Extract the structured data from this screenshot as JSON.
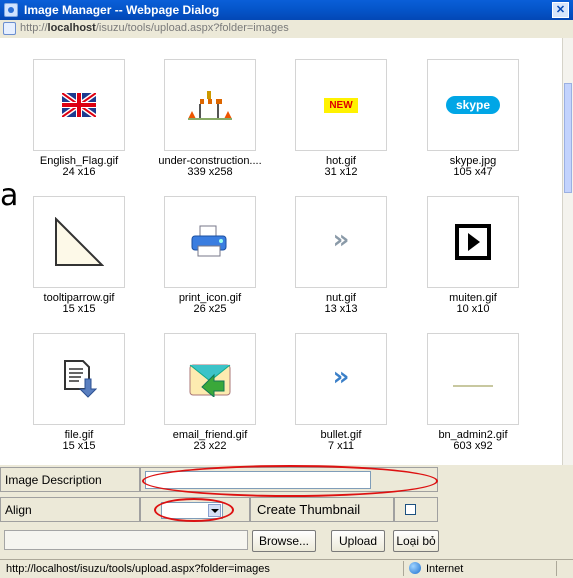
{
  "window": {
    "title": "Image Manager -- Webpage Dialog",
    "address_prefix": "http://",
    "address_host": "localhost",
    "address_path": "/isuzu/tools/upload.aspx?folder=images"
  },
  "side_letter": "a",
  "images": [
    {
      "name": "English_Flag.gif",
      "size": "24 x16",
      "icon": "uk-flag-icon"
    },
    {
      "name": "under-construction....",
      "size": "339 x258",
      "icon": "construction-icon"
    },
    {
      "name": "hot.gif",
      "size": "31 x12",
      "icon": "new-badge-icon",
      "badge": "NEW"
    },
    {
      "name": "skype.jpg",
      "size": "105 x47",
      "icon": "skype-logo-icon",
      "badge": "skype"
    },
    {
      "name": "tooltiparrow.gif",
      "size": "15 x15",
      "icon": "triangle-arrow-icon"
    },
    {
      "name": "print_icon.gif",
      "size": "26 x25",
      "icon": "printer-icon"
    },
    {
      "name": "nut.gif",
      "size": "13 x13",
      "icon": "double-chevron-icon",
      "glyph": "»"
    },
    {
      "name": "muiten.gif",
      "size": "10 x10",
      "icon": "play-box-icon"
    },
    {
      "name": "file.gif",
      "size": "15 x15",
      "icon": "file-download-icon"
    },
    {
      "name": "email_friend.gif",
      "size": "23 x22",
      "icon": "email-friend-icon"
    },
    {
      "name": "bullet.gif",
      "size": "7 x11",
      "icon": "blue-chevron-icon",
      "glyph": "»"
    },
    {
      "name": "bn_admin2.gif",
      "size": "603 x92",
      "icon": "banner-line-icon"
    }
  ],
  "form": {
    "description_label": "Image Description",
    "description_value": "",
    "align_label": "Align",
    "align_value": "",
    "thumbnail_label": "Create Thumbnail",
    "thumbnail_checked": false,
    "file_value": "",
    "browse_label": "Browse...",
    "upload_label": "Upload",
    "cancel_label": "Loại bỏ"
  },
  "status": {
    "url": "http://localhost/isuzu/tools/upload.aspx?folder=images",
    "zone": "Internet"
  },
  "colors": {
    "titlebar": "#0453c7",
    "annotation_red": "#dd1111",
    "dialog_bg": "#ece9d8"
  }
}
